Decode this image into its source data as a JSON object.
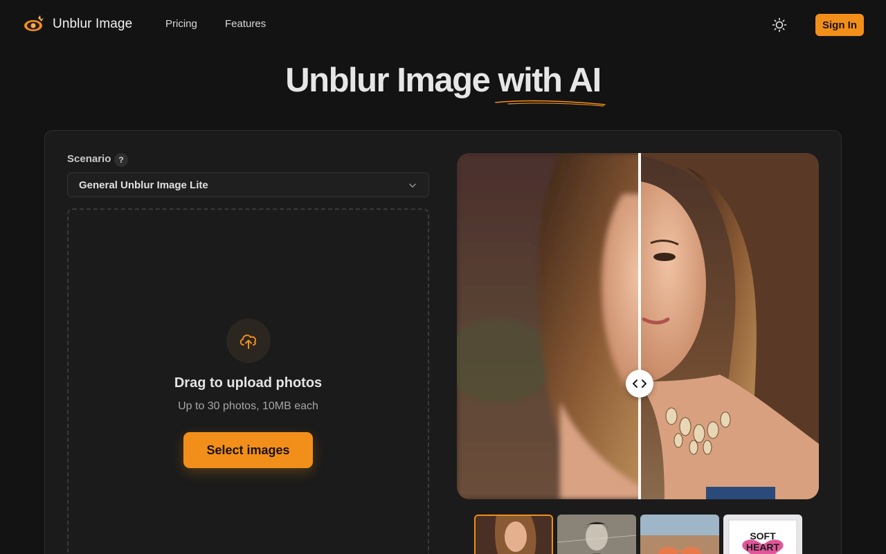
{
  "header": {
    "brand": "Unblur Image",
    "nav": {
      "pricing": "Pricing",
      "features": "Features"
    },
    "signin_label": "Sign In"
  },
  "hero": {
    "title_part1": "Unblur Image ",
    "title_part2": "with AI"
  },
  "form": {
    "scenario_label": "Scenario",
    "help_glyph": "?",
    "scenario_value": "General Unblur Image Lite"
  },
  "upload": {
    "title": "Drag to upload photos",
    "subtitle": "Up to 30 photos, 10MB each",
    "button_label": "Select images"
  },
  "thumbnails": [
    {
      "label": "portrait",
      "active": true
    },
    {
      "label": "old-photo",
      "active": false
    },
    {
      "label": "sunglasses",
      "active": false
    },
    {
      "label": "Soft Heart",
      "active": false
    }
  ],
  "colors": {
    "accent": "#f28f1a",
    "background": "#131313",
    "panel": "#1b1b1b"
  },
  "icons": [
    "logo-icon",
    "sun-icon",
    "help-icon",
    "chevron-down-icon",
    "upload-cloud-icon",
    "compare-handle-icon"
  ]
}
